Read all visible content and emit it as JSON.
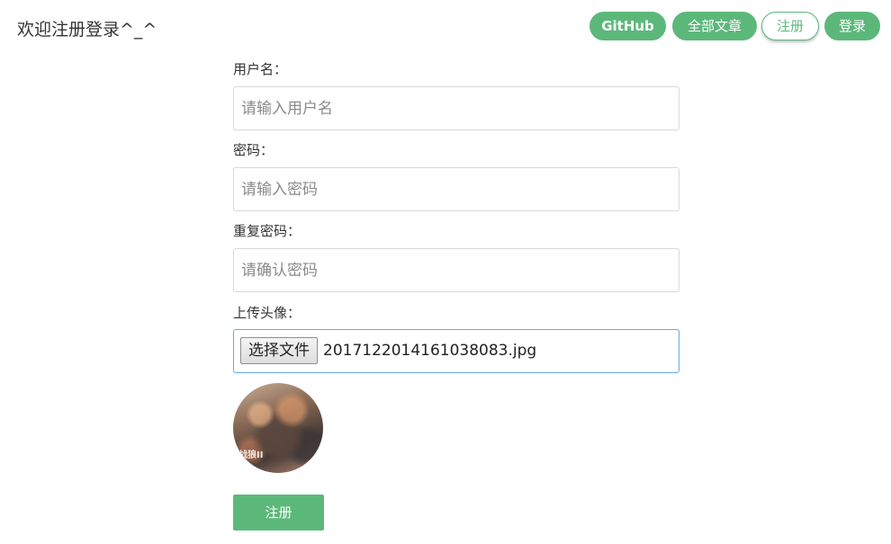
{
  "header": {
    "title": "欢迎注册登录^_^",
    "nav": [
      {
        "label": "GitHub"
      },
      {
        "label": "全部文章"
      },
      {
        "label": "注册"
      },
      {
        "label": "登录"
      }
    ]
  },
  "form": {
    "username": {
      "label": "用户名：",
      "placeholder": "请输入用户名",
      "value": ""
    },
    "password": {
      "label": "密码：",
      "placeholder": "请输入密码",
      "value": ""
    },
    "confirm": {
      "label": "重复密码：",
      "placeholder": "请确认密码",
      "value": ""
    },
    "avatar": {
      "label": "上传头像：",
      "button_label": "选择文件",
      "file_name": "2017122014161038083.jpg",
      "preview_caption": "战狼II"
    },
    "submit_label": "注册"
  },
  "colors": {
    "accent": "#5cb87a",
    "focus_border": "#66a9e8"
  },
  "icons": {
    "avatar_preview": "avatar-image"
  }
}
